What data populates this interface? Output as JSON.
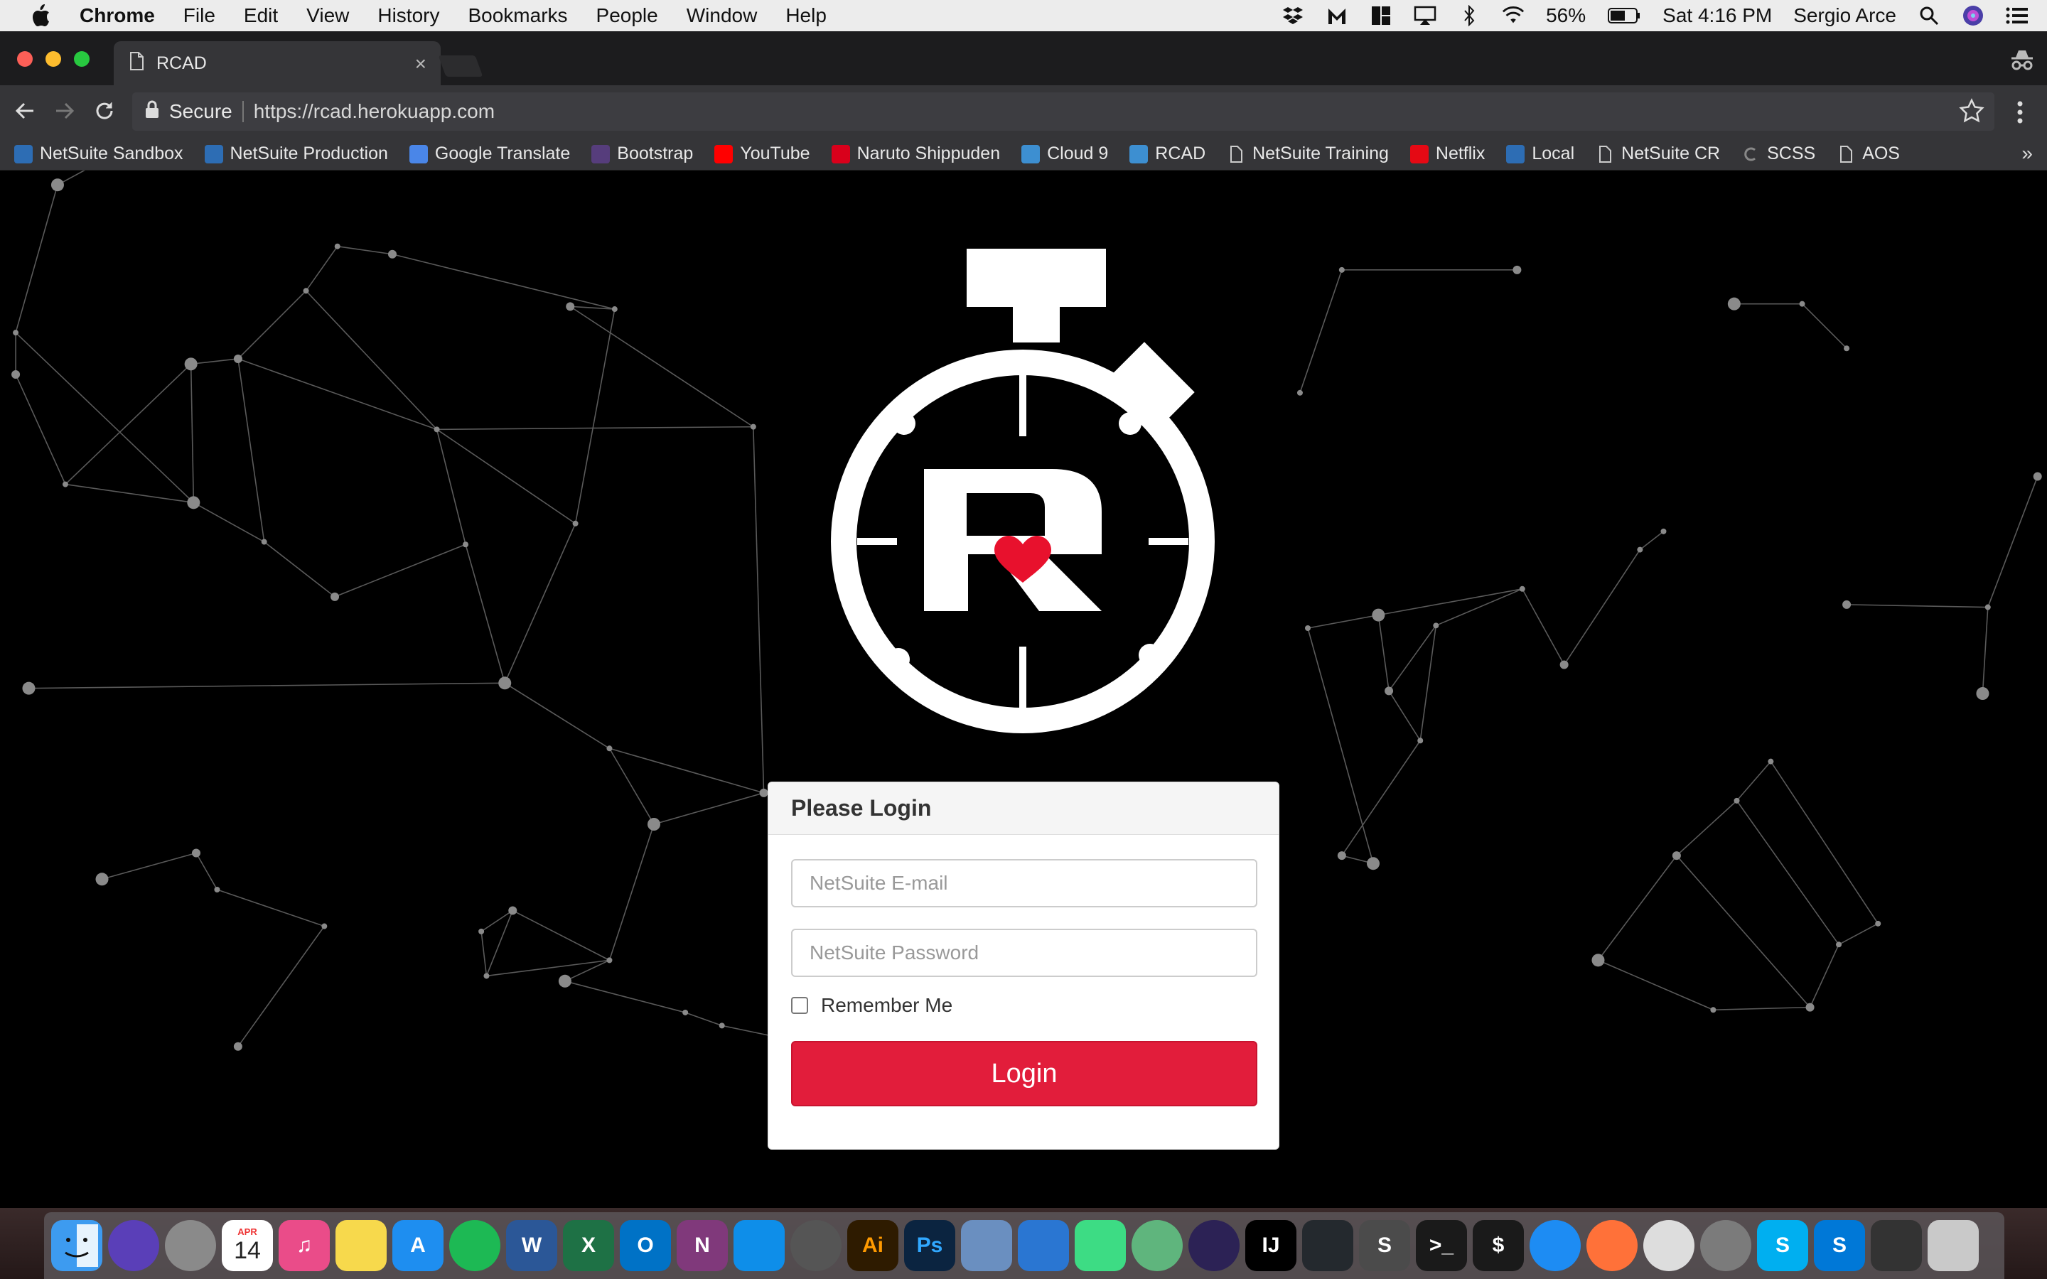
{
  "menubar": {
    "app_name": "Chrome",
    "menus": [
      "File",
      "Edit",
      "View",
      "History",
      "Bookmarks",
      "People",
      "Window",
      "Help"
    ],
    "battery": "56%",
    "clock": "Sat 4:16 PM",
    "user": "Sergio Arce"
  },
  "browser": {
    "tab_title": "RCAD",
    "tab_close": "×",
    "secure_label": "Secure",
    "url": "https://rcad.herokuapp.com",
    "bookmarks_overflow": "»",
    "bookmarks": [
      {
        "label": "NetSuite Sandbox",
        "icon": "netsuite-icon",
        "color": "#2d6db4"
      },
      {
        "label": "NetSuite Production",
        "icon": "netsuite-icon",
        "color": "#2d6db4"
      },
      {
        "label": "Google Translate",
        "icon": "google-translate-icon",
        "color": "#4a86e8"
      },
      {
        "label": "Bootstrap",
        "icon": "bootstrap-icon",
        "color": "#563d7c"
      },
      {
        "label": "YouTube",
        "icon": "youtube-icon",
        "color": "#ff0000"
      },
      {
        "label": "Naruto Shippuden",
        "icon": "naruto-icon",
        "color": "#d9001b"
      },
      {
        "label": "Cloud 9",
        "icon": "cloud9-icon",
        "color": "#3d8fd1"
      },
      {
        "label": "RCAD",
        "icon": "rcad-icon",
        "color": "#3d8fd1"
      },
      {
        "label": "NetSuite Training",
        "icon": "page-icon",
        "color": "#353538"
      },
      {
        "label": "Netflix",
        "icon": "netflix-icon",
        "color": "#e50914"
      },
      {
        "label": "Local",
        "icon": "local-icon",
        "color": "#2d6db4"
      },
      {
        "label": "NetSuite CR",
        "icon": "page-icon",
        "color": "#353538"
      },
      {
        "label": "SCSS",
        "icon": "scss-icon",
        "color": "#353538"
      },
      {
        "label": "AOS",
        "icon": "page-icon",
        "color": "#353538"
      }
    ]
  },
  "login": {
    "heading": "Please Login",
    "email_placeholder": "NetSuite E-mail",
    "password_placeholder": "NetSuite Password",
    "remember_label": "Remember Me",
    "submit_label": "Login",
    "accent": "#e21d3b"
  },
  "dock": {
    "calendar_month": "APR",
    "calendar_day": "14",
    "apps": [
      {
        "name": "finder-icon",
        "label": "",
        "color": "#3d9bf0"
      },
      {
        "name": "siri-icon",
        "label": "",
        "color": "#5a3fb8"
      },
      {
        "name": "launchpad-icon",
        "label": "",
        "color": "#8a8a8a"
      },
      {
        "name": "calendar-icon",
        "label": "",
        "color": "#ffffff"
      },
      {
        "name": "itunes-icon",
        "label": "♫",
        "color": "#ea4c89"
      },
      {
        "name": "notes-icon",
        "label": "",
        "color": "#f7d94c"
      },
      {
        "name": "app-store-icon",
        "label": "A",
        "color": "#1e8ef0"
      },
      {
        "name": "spotify-icon",
        "label": "",
        "color": "#1db954"
      },
      {
        "name": "word-icon",
        "label": "W",
        "color": "#2b5797"
      },
      {
        "name": "excel-icon",
        "label": "X",
        "color": "#1e7145"
      },
      {
        "name": "outlook-icon",
        "label": "O",
        "color": "#0072c6"
      },
      {
        "name": "onenote-icon",
        "label": "N",
        "color": "#80397b"
      },
      {
        "name": "teamviewer-icon",
        "label": "",
        "color": "#0e8ee9"
      },
      {
        "name": "instruments-icon",
        "label": "",
        "color": "#555555"
      },
      {
        "name": "illustrator-icon",
        "label": "Ai",
        "color": "#2e1b00"
      },
      {
        "name": "photoshop-icon",
        "label": "Ps",
        "color": "#0b2440"
      },
      {
        "name": "virtualbox-icon",
        "label": "",
        "color": "#6a8fc0"
      },
      {
        "name": "xcode-icon",
        "label": "",
        "color": "#2a76d2"
      },
      {
        "name": "android-studio-icon",
        "label": "",
        "color": "#3ddc84"
      },
      {
        "name": "atom-icon",
        "label": "",
        "color": "#5fb57d"
      },
      {
        "name": "eclipse-icon",
        "label": "",
        "color": "#2c2255"
      },
      {
        "name": "intellij-icon",
        "label": "IJ",
        "color": "#000000"
      },
      {
        "name": "vscode-icon",
        "label": "",
        "color": "#24292e"
      },
      {
        "name": "sublime-icon",
        "label": "S",
        "color": "#4b4b4b"
      },
      {
        "name": "terminal-icon",
        "label": ">_",
        "color": "#1a1a1a"
      },
      {
        "name": "console-icon",
        "label": "$",
        "color": "#1a1a1a"
      },
      {
        "name": "safari-icon",
        "label": "",
        "color": "#1d8cf3"
      },
      {
        "name": "firefox-icon",
        "label": "",
        "color": "#ff7139"
      },
      {
        "name": "chrome-icon",
        "label": "",
        "color": "#dddddd"
      },
      {
        "name": "system-preferences-icon",
        "label": "",
        "color": "#7b7b7b"
      },
      {
        "name": "skype-icon",
        "label": "S",
        "color": "#00aff0"
      },
      {
        "name": "skype-business-icon",
        "label": "S",
        "color": "#0078d7"
      },
      {
        "name": "screen-icon",
        "label": "",
        "color": "#333333"
      },
      {
        "name": "trash-icon",
        "label": "",
        "color": "#c9c9c9"
      }
    ]
  }
}
